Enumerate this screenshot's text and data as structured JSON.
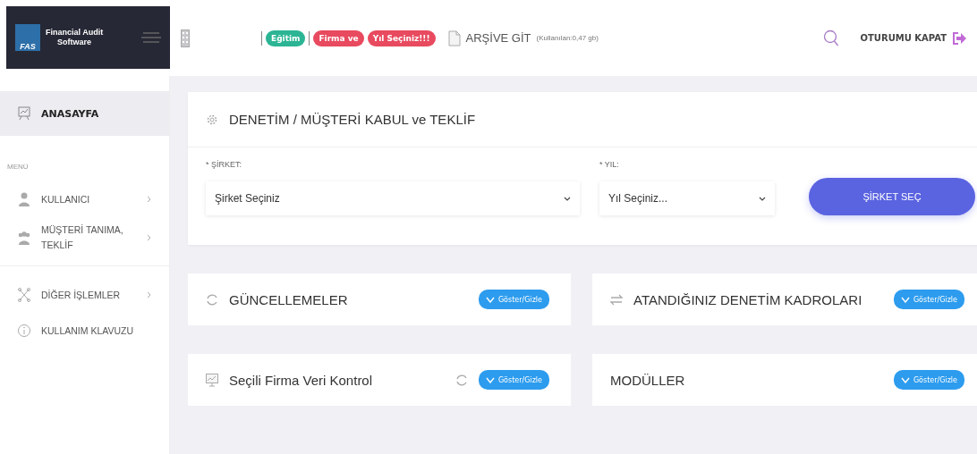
{
  "logo": {
    "title": "Financial Audit",
    "subtitle": "Software",
    "mark": "FAS"
  },
  "header": {
    "badges": [
      {
        "label": "Eğitim",
        "color": "#2bb594"
      },
      {
        "label": "Firma ve",
        "color": "#e84a5f"
      },
      {
        "label": "Yıl Seçiniz!!!",
        "color": "#e84a5f"
      }
    ],
    "archive": {
      "label": "ARŞİVE GİT",
      "usage": "(Kullanılan:0,47 gb)"
    },
    "logout": "OTURUMU KAPAT"
  },
  "sidebar": {
    "home": {
      "label": "ANASAYFA",
      "selected": true
    },
    "section": "MENÜ",
    "items": [
      {
        "kind": "user",
        "label": "KULLANICI",
        "has_submenu": true,
        "divider_after": false
      },
      {
        "kind": "group",
        "label": "MÜŞTERİ TANIMA, TEKLİF",
        "has_submenu": true,
        "divider_after": true
      },
      {
        "kind": "network",
        "label": "DİĞER İŞLEMLER",
        "has_submenu": true,
        "divider_after": false
      },
      {
        "kind": "info",
        "label": "KULLANIM KLAVUZU",
        "has_submenu": false,
        "divider_after": false
      }
    ]
  },
  "main_card": {
    "title": "DENETİM / MÜŞTERİ KABUL ve TEKLİF",
    "company": {
      "label": "* ŞİRKET:",
      "value": "Şirket Seçiniz"
    },
    "year": {
      "label": "* YIL:",
      "value": "Yıl Seçiniz..."
    },
    "submit": "ŞİRKET SEÇ"
  },
  "panels": [
    {
      "kind": "refresh",
      "title": "GÜNCELLEMELER",
      "refresh_button": false,
      "toggle": "Göster/Gizle"
    },
    {
      "kind": "swap",
      "title": "ATANDIĞINIZ DENETİM KADROLARI",
      "refresh_button": false,
      "toggle": "Göster/Gizle"
    },
    {
      "kind": "chart",
      "title": "Seçili Firma Veri Kontrol",
      "refresh_button": true,
      "toggle": "Göster/Gizle"
    },
    {
      "kind": "none",
      "title": "MODÜLLER",
      "refresh_button": false,
      "toggle": "Göster/Gizle"
    }
  ]
}
